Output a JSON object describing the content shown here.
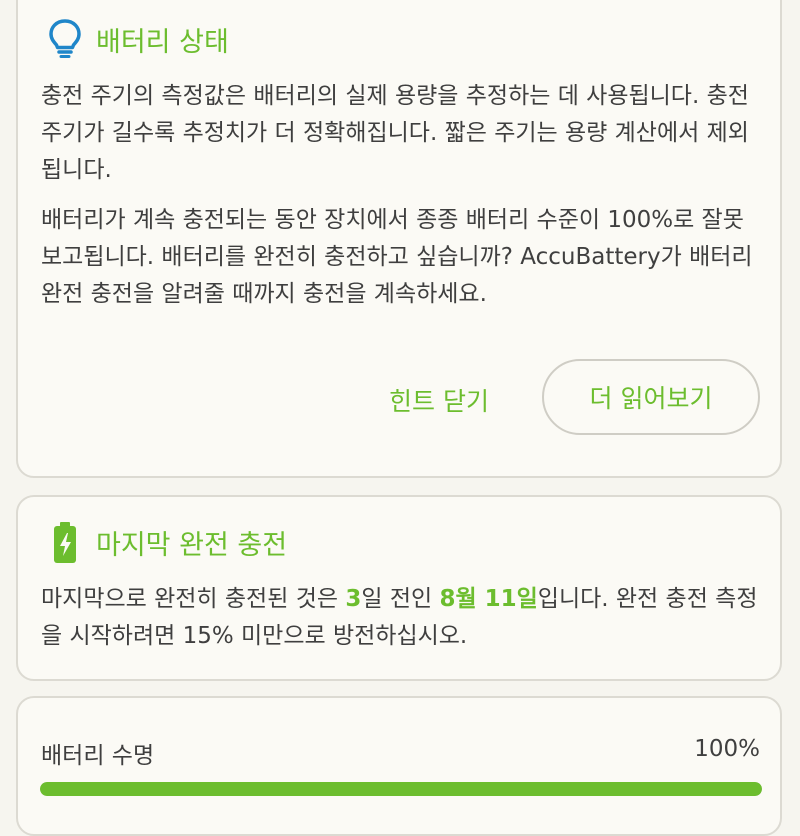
{
  "colors": {
    "accent": "#6cbd2e",
    "card_bg": "#fbfaf5",
    "page_bg": "#f6f5ef"
  },
  "tip_card": {
    "icon": "lightbulb-icon",
    "title": "배터리 상태",
    "paragraph1": "충전 주기의 측정값은 배터리의 실제 용량을 추정하는 데 사용됩니다. 충전 주기가 길수록 추정치가 더 정확해집니다. 짧은 주기는 용량 계산에서 제외됩니다.",
    "paragraph2": "배터리가 계속 충전되는 동안 장치에서 종종 배터리 수준이 100%로 잘못 보고됩니다. 배터리를 완전히 충전하고 싶습니까? AccuBattery가 배터리 완전 충전을 알려줄 때까지 충전을 계속하세요.",
    "dismiss_label": "힌트 닫기",
    "read_more_label": "더 읽어보기"
  },
  "full_charge_card": {
    "icon": "battery-charging-icon",
    "title": "마지막 완전 충전",
    "text_part1": "마지막으로 완전히 충전된 것은 ",
    "days": "3",
    "text_part2": "일 전인 ",
    "date": "8월 11일",
    "text_part3": "입니다. 완전 충전 측정을 시작하려면 15% 미만으로 방전하십시오."
  },
  "health_card": {
    "label": "배터리 수명",
    "value_text": "100%",
    "progress": 1.0
  }
}
